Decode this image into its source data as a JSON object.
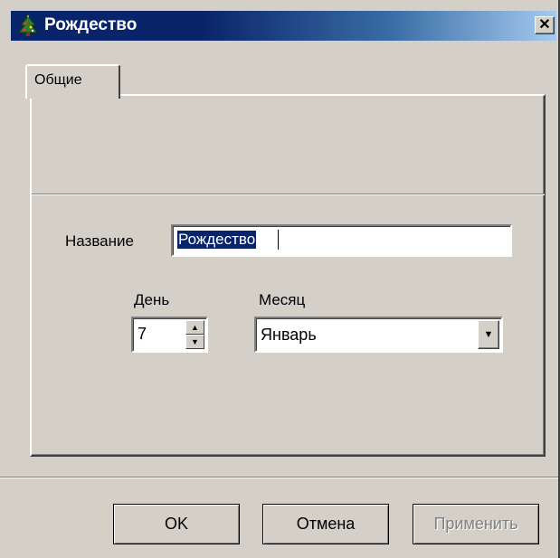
{
  "window": {
    "title": "Рождество",
    "title_icon": "christmas-tree-icon",
    "close_glyph": "✕"
  },
  "tabs": [
    {
      "label": "Общие",
      "selected": true
    }
  ],
  "form": {
    "name_label": "Название",
    "name_value": "Рождество",
    "day_label": "День",
    "day_value": "7",
    "month_label": "Месяц",
    "month_value": "Январь"
  },
  "buttons": {
    "ok": "OK",
    "cancel": "Отмена",
    "apply": "Применить"
  },
  "colors": {
    "face": "#d4d0c8",
    "title_start": "#08246b",
    "title_end": "#a6caf0",
    "selection": "#0a246a"
  }
}
